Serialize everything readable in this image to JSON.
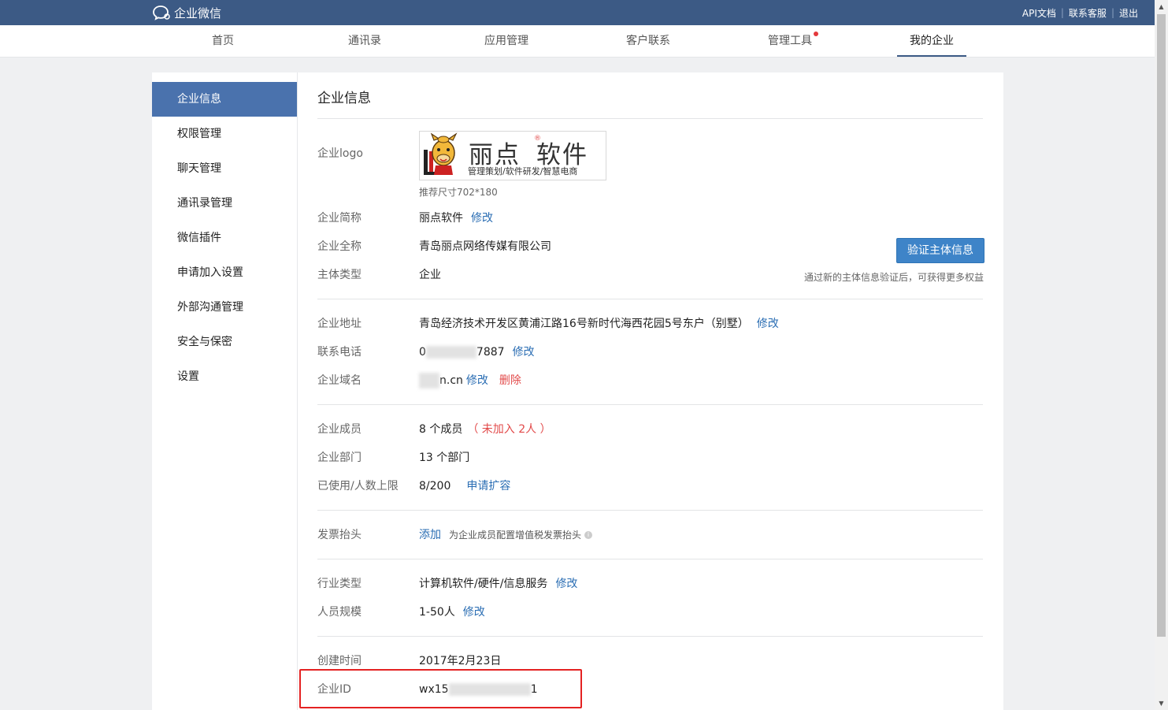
{
  "header": {
    "brand": "企业微信",
    "links": [
      "API文档",
      "联系客服",
      "退出"
    ]
  },
  "nav": {
    "tabs": [
      "首页",
      "通讯录",
      "应用管理",
      "客户联系",
      "管理工具",
      "我的企业"
    ],
    "active": "我的企业"
  },
  "sidebar": {
    "items": [
      "企业信息",
      "权限管理",
      "聊天管理",
      "通讯录管理",
      "微信插件",
      "申请加入设置",
      "外部沟通管理",
      "安全与保密",
      "设置"
    ]
  },
  "content": {
    "title": "企业信息",
    "logo_label": "企业logo",
    "logo": {
      "name": "丽点",
      "name2": "软件",
      "mark": "®",
      "subtitle": "管理策划/软件研发/智慧电商"
    },
    "logo_hint": "推荐尺寸702*180",
    "short_name_label": "企业简称",
    "short_name": "丽点软件",
    "full_name_label": "企业全称",
    "full_name": "青岛丽点网络传媒有限公司",
    "type_label": "主体类型",
    "type": "企业",
    "verify_button": "验证主体信息",
    "verify_hint": "通过新的主体信息验证后，可获得更多权益",
    "address_label": "企业地址",
    "address": "青岛经济技术开发区黄浦江路16号新时代海西花园5号东户（别墅）",
    "phone_label": "联系电话",
    "phone_prefix": "0",
    "phone_suffix": "7887",
    "domain_label": "企业域名",
    "domain_suffix": "n.cn",
    "members_label": "企业成员",
    "members": "8 个成员",
    "members_pending": "（ 未加入 2人 ）",
    "departments_label": "企业部门",
    "departments": "13 个部门",
    "usage_label": "已使用/人数上限",
    "usage": "8/200",
    "usage_link": "申请扩容",
    "invoice_label": "发票抬头",
    "invoice_link": "添加",
    "invoice_hint": "为企业成员配置增值税发票抬头",
    "industry_label": "行业类型",
    "industry": "计算机软件/硬件/信息服务",
    "scale_label": "人员规模",
    "scale": "1-50人",
    "created_label": "创建时间",
    "created": "2017年2月23日",
    "id_label": "企业ID",
    "id_prefix": "wx15",
    "id_suffix": "1",
    "edit": "修改",
    "delete": "删除"
  },
  "colors": {
    "topbar": "#3c5a85",
    "sidebar_active": "#4a72ad",
    "link": "#2a6db3",
    "warn": "#e24a4a",
    "button": "#3e84c8",
    "highlight_box": "#e42222"
  }
}
